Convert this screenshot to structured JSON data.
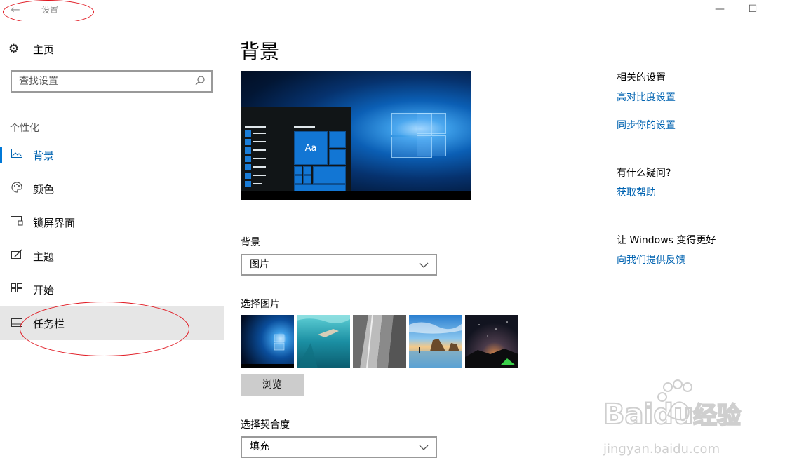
{
  "window": {
    "title": "设置",
    "back_glyph": "←",
    "min_glyph": "—",
    "max_glyph": "☐"
  },
  "sidebar": {
    "home_label": "主页",
    "search_placeholder": "查找设置",
    "section_heading": "个性化",
    "items": [
      {
        "label": "背景",
        "icon": "picture-icon",
        "state": "selected"
      },
      {
        "label": "颜色",
        "icon": "palette-icon"
      },
      {
        "label": "锁屏界面",
        "icon": "lock-screen-icon"
      },
      {
        "label": "主题",
        "icon": "theme-brush-icon"
      },
      {
        "label": "开始",
        "icon": "start-grid-icon"
      },
      {
        "label": "任务栏",
        "icon": "taskbar-icon",
        "state": "hover"
      }
    ]
  },
  "main": {
    "title": "背景",
    "preview_tile_text": "Aa",
    "background_label": "背景",
    "background_value": "图片",
    "choose_picture_label": "选择图片",
    "browse_label": "浏览",
    "fit_label": "选择契合度",
    "fit_value": "填充"
  },
  "related": {
    "heading": "相关的设置",
    "link_contrast": "高对比度设置",
    "link_sync": "同步你的设置",
    "question_heading": "有什么疑问?",
    "link_help": "获取帮助",
    "improve_heading": "让 Windows 变得更好",
    "link_feedback": "向我们提供反馈"
  },
  "watermark": {
    "brand": "Baidu",
    "cn": "经验",
    "url": "jingyan.baidu.com"
  },
  "colors": {
    "accent": "#0078d7",
    "link": "#0063b1",
    "annotation": "#e0141d",
    "hover_bg": "#e6e6e6"
  }
}
